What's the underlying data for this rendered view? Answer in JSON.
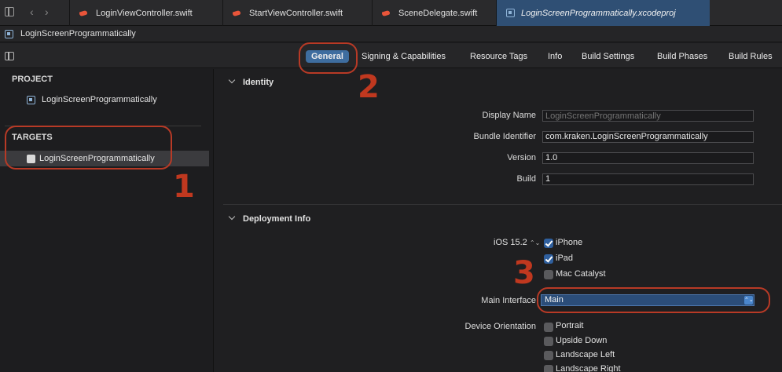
{
  "tabs": [
    {
      "label": "LoginViewController.swift",
      "kind": "swift"
    },
    {
      "label": "StartViewController.swift",
      "kind": "swift"
    },
    {
      "label": "SceneDelegate.swift",
      "kind": "swift"
    },
    {
      "label": "LoginScreenProgrammatically.xcodeproj",
      "kind": "project",
      "active": true
    }
  ],
  "nav_arrows": {
    "back": "‹",
    "forward": "›"
  },
  "breadcrumb": "LoginScreenProgrammatically",
  "editor_tabs": [
    "General",
    "Signing & Capabilities",
    "Resource Tags",
    "Info",
    "Build Settings",
    "Build Phases",
    "Build Rules"
  ],
  "navigator": {
    "project_header": "PROJECT",
    "project_item": "LoginScreenProgrammatically",
    "targets_header": "TARGETS",
    "target_item": "LoginScreenProgrammatically"
  },
  "identity": {
    "title": "Identity",
    "display_name_label": "Display Name",
    "display_name_placeholder": "LoginScreenProgrammatically",
    "bundle_id_label": "Bundle Identifier",
    "bundle_id_value": "com.kraken.LoginScreenProgrammatically",
    "version_label": "Version",
    "version_value": "1.0",
    "build_label": "Build",
    "build_value": "1"
  },
  "deployment": {
    "title": "Deployment Info",
    "ios_version": "iOS 15.2",
    "ios_stepper": "⌃⌄",
    "devices": [
      {
        "label": "iPhone",
        "checked": true
      },
      {
        "label": "iPad",
        "checked": true
      },
      {
        "label": "Mac Catalyst",
        "checked": false
      }
    ],
    "main_interface_label": "Main Interface",
    "main_interface_value": "Main",
    "main_interface_chevron": "⌃⌄",
    "orientation_label": "Device Orientation",
    "orientations": [
      {
        "label": "Portrait",
        "checked": false
      },
      {
        "label": "Upside Down",
        "checked": false
      },
      {
        "label": "Landscape Left",
        "checked": false
      },
      {
        "label": "Landscape Right",
        "checked": false
      }
    ]
  },
  "annotations": {
    "one": "1",
    "two": "2",
    "three": "3"
  },
  "colors": {
    "accent": "#3e6d9f",
    "annotation": "#c0381f",
    "background": "#1f1f21"
  }
}
